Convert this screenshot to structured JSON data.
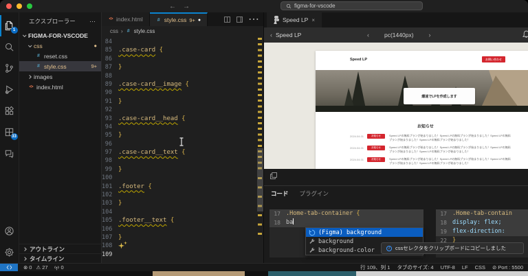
{
  "icons": {
    "back": "←",
    "forward": "→",
    "more": "⋯",
    "close": "×",
    "error": "⊗",
    "warning": "⚠",
    "no_entry": "⊘"
  },
  "titlebar": {
    "search_value": "figma-for-vscode"
  },
  "activity_bar": {
    "explorer_badge": "1",
    "grid_badge": "33"
  },
  "sidebar": {
    "title": "エクスプローラー",
    "root_label": "FIGMA-FOR-VSCODE",
    "items": [
      {
        "label": "css",
        "badge": "●"
      },
      {
        "label": "reset.css",
        "badge": ""
      },
      {
        "label": "style.css",
        "badge": "9+"
      },
      {
        "label": "images",
        "badge": ""
      },
      {
        "label": "index.html",
        "badge": ""
      }
    ],
    "outline_label": "アウトライン",
    "timeline_label": "タイムライン"
  },
  "editor": {
    "tabs": [
      {
        "label": "index.html",
        "badge": "",
        "dirty": ""
      },
      {
        "label": "style.css",
        "badge": "9+",
        "dirty": "●"
      }
    ],
    "breadcrumb": {
      "folder": "css",
      "file": "style.css"
    },
    "lines": [
      {
        "no": 84,
        "kind": "blank",
        "text": ""
      },
      {
        "no": 85,
        "kind": "selector",
        "text": ".case-card {"
      },
      {
        "no": 86,
        "kind": "blank",
        "text": ""
      },
      {
        "no": 87,
        "kind": "close",
        "text": "}"
      },
      {
        "no": 88,
        "kind": "blank",
        "text": ""
      },
      {
        "no": 89,
        "kind": "selector",
        "text": ".case-card__image {"
      },
      {
        "no": 90,
        "kind": "blank",
        "text": ""
      },
      {
        "no": 91,
        "kind": "close",
        "text": "}"
      },
      {
        "no": 92,
        "kind": "blank",
        "text": ""
      },
      {
        "no": 93,
        "kind": "selector",
        "text": ".case-card__head {"
      },
      {
        "no": 94,
        "kind": "blank",
        "text": ""
      },
      {
        "no": 95,
        "kind": "close",
        "text": "}"
      },
      {
        "no": 96,
        "kind": "blank",
        "text": ""
      },
      {
        "no": 97,
        "kind": "selector",
        "text": ".case-card__text {"
      },
      {
        "no": 98,
        "kind": "blank",
        "text": ""
      },
      {
        "no": 99,
        "kind": "close",
        "text": "}"
      },
      {
        "no": 100,
        "kind": "blank",
        "text": ""
      },
      {
        "no": 101,
        "kind": "selector",
        "text": ".footer {"
      },
      {
        "no": 102,
        "kind": "blank",
        "text": ""
      },
      {
        "no": 103,
        "kind": "close",
        "text": "}"
      },
      {
        "no": 104,
        "kind": "blank",
        "text": ""
      },
      {
        "no": 105,
        "kind": "selector",
        "text": ".footer__text {"
      },
      {
        "no": 106,
        "kind": "blank",
        "text": ""
      },
      {
        "no": 107,
        "kind": "close",
        "text": "}"
      },
      {
        "no": 108,
        "kind": "sparkle",
        "text": ""
      },
      {
        "no": 109,
        "kind": "active",
        "text": ""
      }
    ]
  },
  "figma": {
    "tab_label": "Speed LP",
    "toolbar": {
      "back_label": "Speed LP",
      "frame_label": "pc(1440px)"
    },
    "site": {
      "logo": "Speed LP",
      "cta": "お問い合わせ",
      "hero_caption": "爆速でLPを作成します",
      "news_heading": "お知らせ",
      "news": [
        {
          "date": "2024.04.01",
          "badge": "お知らせ",
          "text": "Speed LPの無料プランが始まりました！Speed LPの無料プランが始まりました！Speed LPの無料プランが始まりました！Speed LPの無料プランが始まりました！"
        },
        {
          "date": "2024.04.01",
          "badge": "お知らせ",
          "text": "Speed LPの無料プランが始まりました！Speed LPの無料プランが始まりました！Speed LPの無料プランが始まりました！Speed LPの無料プランが始まりました！"
        },
        {
          "date": "2024.04.01",
          "badge": "お知らせ",
          "text": "Speed LPの無料プランが始まりました！Speed LPの無料プランが始まりました！Speed LPの無料プランが始まりました！Speed LPの無料プランが始まりました！"
        }
      ]
    },
    "code_tabs": [
      "コード",
      "プラグイン"
    ],
    "left_code": {
      "rows": [
        {
          "no": "17",
          "sel": ".Home-tab-container",
          "brace": " {"
        },
        {
          "no": "18",
          "text": "ba"
        }
      ]
    },
    "suggest": [
      {
        "label": "(Figma) background"
      },
      {
        "label": "background"
      },
      {
        "label": "background-color"
      }
    ],
    "right_code": {
      "rows": [
        {
          "no": "17",
          "text": ".Home-tab-contain"
        },
        {
          "no": "18",
          "text": "display: flex;"
        },
        {
          "no": "19",
          "text": "flex-direction:"
        },
        {
          "no": "22",
          "text": "}"
        }
      ]
    },
    "toast": "cssセレクタをクリップボードにコピーしました"
  },
  "status_bar": {
    "errors": "0",
    "warnings": "27",
    "ports": "0",
    "cursor": "行 109、列 1",
    "tab_size": "タブのサイズ: 4",
    "encoding": "UTF-8",
    "eol": "LF",
    "language": "CSS",
    "port": "Port : 5500"
  }
}
